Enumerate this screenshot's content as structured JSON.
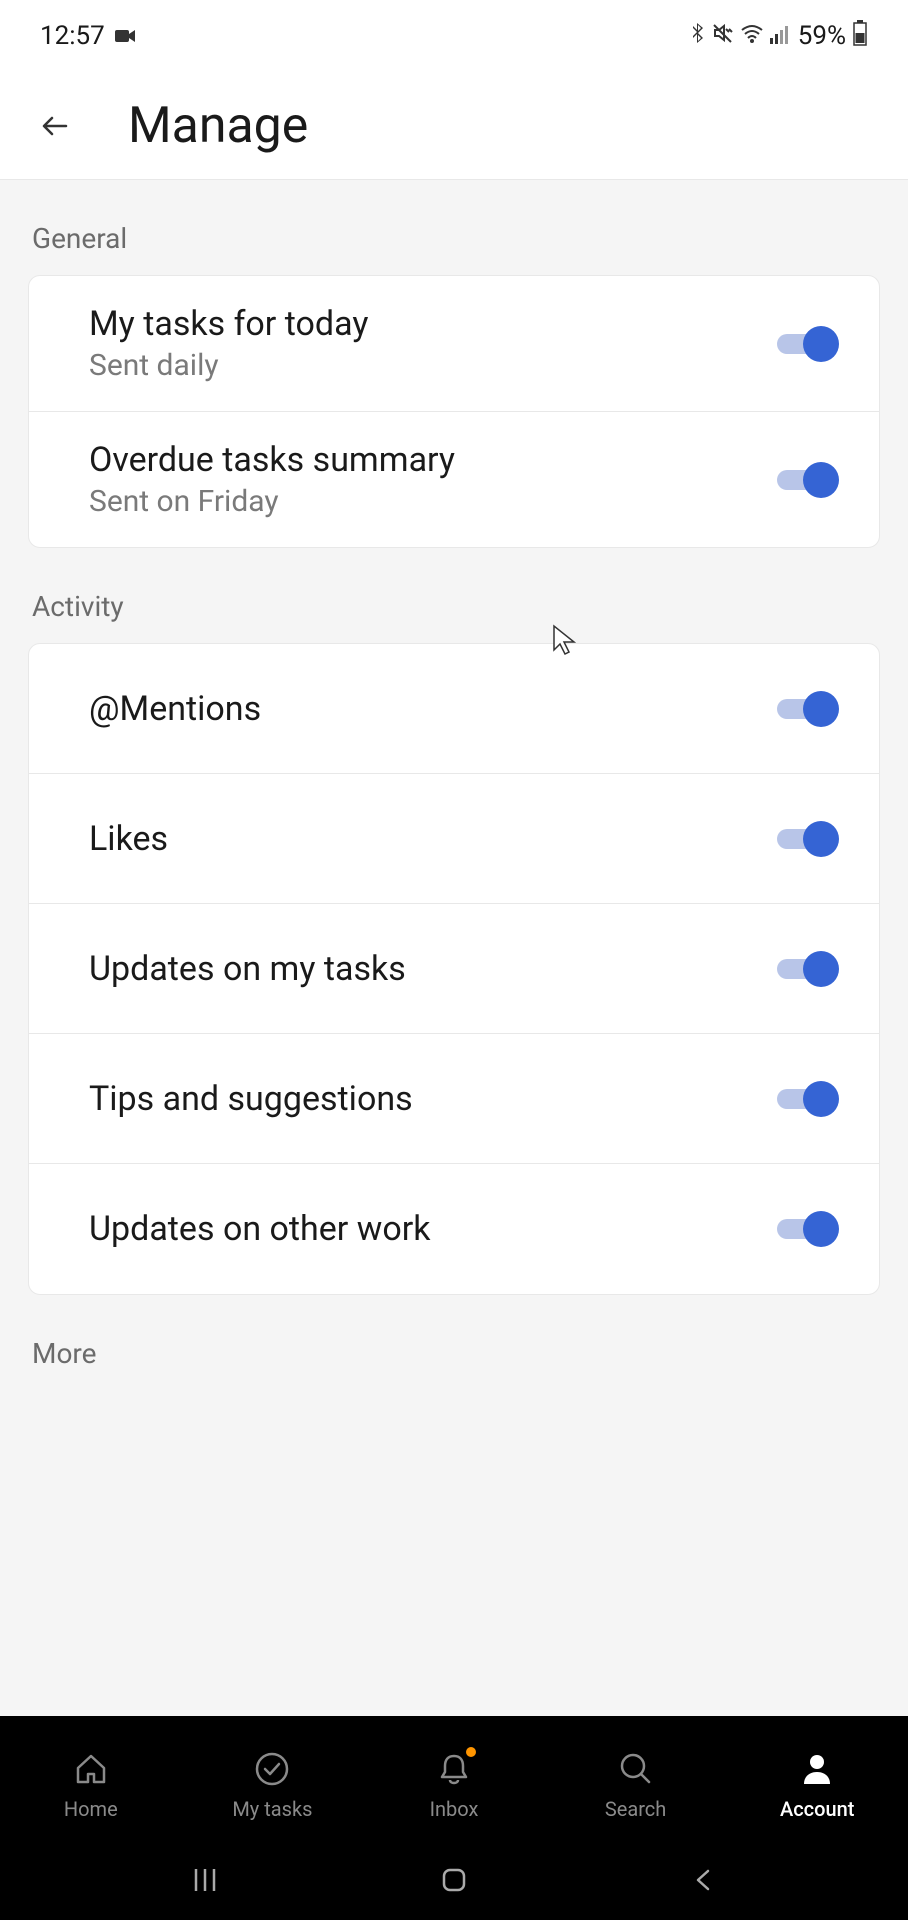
{
  "status_bar": {
    "time": "12:57",
    "battery_percent": "59%"
  },
  "header": {
    "title": "Manage"
  },
  "sections": {
    "general": {
      "header": "General",
      "items": [
        {
          "title": "My tasks for today",
          "subtitle": "Sent daily",
          "on": true
        },
        {
          "title": "Overdue tasks summary",
          "subtitle": "Sent on Friday",
          "on": true
        }
      ]
    },
    "activity": {
      "header": "Activity",
      "items": [
        {
          "title": "@Mentions",
          "on": true
        },
        {
          "title": "Likes",
          "on": true
        },
        {
          "title": "Updates on my tasks",
          "on": true
        },
        {
          "title": "Tips and suggestions",
          "on": true
        },
        {
          "title": "Updates on other work",
          "on": true
        }
      ]
    },
    "more": {
      "header": "More"
    }
  },
  "bottom_nav": {
    "tabs": [
      {
        "label": "Home",
        "icon": "home-icon",
        "active": false
      },
      {
        "label": "My tasks",
        "icon": "checkmark-circle-icon",
        "active": false
      },
      {
        "label": "Inbox",
        "icon": "bell-icon",
        "active": false,
        "badge": true
      },
      {
        "label": "Search",
        "icon": "search-icon",
        "active": false
      },
      {
        "label": "Account",
        "icon": "person-icon",
        "active": true
      }
    ]
  }
}
